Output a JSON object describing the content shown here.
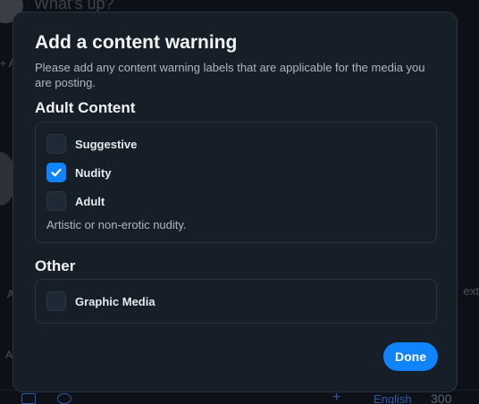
{
  "background": {
    "placeholder": "What's up?",
    "language": "English",
    "char_count": "300",
    "right_fragment": "ext"
  },
  "dialog": {
    "title": "Add a content warning",
    "description": "Please add any content warning labels that are applicable for the media you are posting.",
    "adult_section": {
      "heading": "Adult Content",
      "options": [
        {
          "label": "Suggestive",
          "checked": false
        },
        {
          "label": "Nudity",
          "checked": true
        },
        {
          "label": "Adult",
          "checked": false
        }
      ],
      "hint": "Artistic or non-erotic nudity."
    },
    "other_section": {
      "heading": "Other",
      "options": [
        {
          "label": "Graphic Media",
          "checked": false
        }
      ]
    },
    "done_label": "Done"
  },
  "colors": {
    "accent": "#1083fe",
    "dialog_bg": "#161e27",
    "border": "#2a3440"
  }
}
